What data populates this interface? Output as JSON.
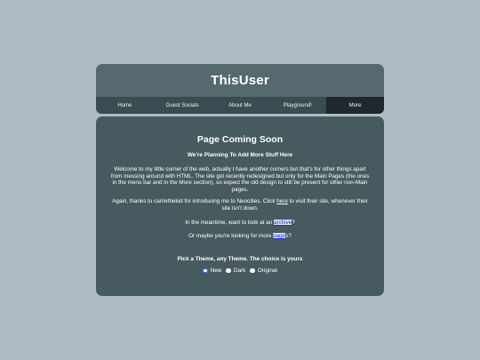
{
  "header": {
    "title": "ThisUser"
  },
  "nav": {
    "items": [
      {
        "label": "Home"
      },
      {
        "label": "Guest Socials"
      },
      {
        "label": "About Me"
      },
      {
        "label": "Playground!"
      },
      {
        "label": "More",
        "active": true
      }
    ]
  },
  "main": {
    "heading": "Page Coming Soon",
    "subheading": "We're Planning To Add More Stuff Here",
    "welcome_text": "Welcome to my little corner of the web, actually I have another corners but that's for other things apart from messing around with HTML. The site got recently redesigned but only for the Main Pages (the ones in the menu bar and in the More section), so expect the old design to still be present for other non-Main pages.",
    "thanks_before": "Again, thanks to carriethekid for introducing me to Neocities. Click ",
    "thanks_link": "here",
    "thanks_after": " to visit their site, whenever their site isn't down.",
    "archive_before": "In the meantime, want to look at an ",
    "archive_link": "archive",
    "archive_after": "?",
    "pages_before": "Or maybe you're looking for more ",
    "pages_link": "page",
    "pages_after": "s?"
  },
  "theme": {
    "title": "Pick a Theme, any Theme. The choice is yours",
    "options": [
      {
        "label": "New",
        "selected": true
      },
      {
        "label": "Dark",
        "selected": false
      },
      {
        "label": "Original",
        "selected": false
      }
    ],
    "accent_color": "#2f78e6"
  },
  "colors": {
    "page_background": "#afbcc3",
    "header_background": "#55696f",
    "nav_background": "#3a4b51",
    "nav_active_background": "#1f292d",
    "content_background": "#475a60",
    "link_color": "#1f2fd6"
  }
}
